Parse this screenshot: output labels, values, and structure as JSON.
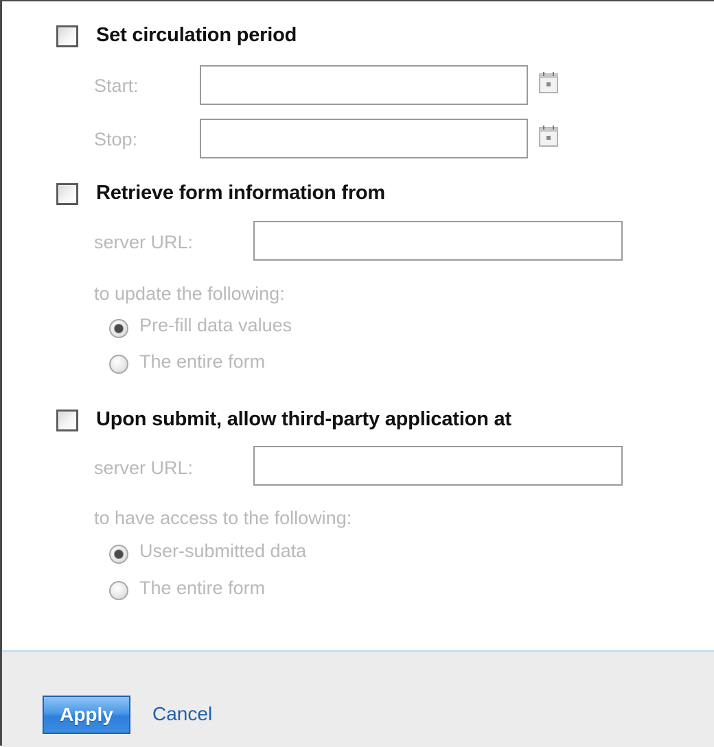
{
  "circulation": {
    "label": "Set circulation period",
    "checked": false,
    "start_label": "Start:",
    "start_value": "",
    "stop_label": "Stop:",
    "stop_value": "",
    "calendar_icon": "calendar-icon"
  },
  "retrieve": {
    "label": "Retrieve form information from",
    "checked": false,
    "server_label": "server URL:",
    "server_value": "",
    "subheading": "to update the following:",
    "options": [
      {
        "label": "Pre-fill data values",
        "selected": true
      },
      {
        "label": "The entire form",
        "selected": false
      }
    ]
  },
  "submit": {
    "label": "Upon submit, allow third-party application at",
    "checked": false,
    "server_label": "server URL:",
    "server_value": "",
    "subheading": "to have access to the following:",
    "options": [
      {
        "label": "User-submitted data",
        "selected": true
      },
      {
        "label": "The entire form",
        "selected": false
      }
    ]
  },
  "footer": {
    "apply_label": "Apply",
    "cancel_label": "Cancel"
  },
  "colors": {
    "accent": "#2f7fda",
    "link": "#1f5fa8",
    "disabled_text": "#b9b9b9",
    "footer_bg": "#ececec",
    "footer_border": "#bcd9ee"
  }
}
